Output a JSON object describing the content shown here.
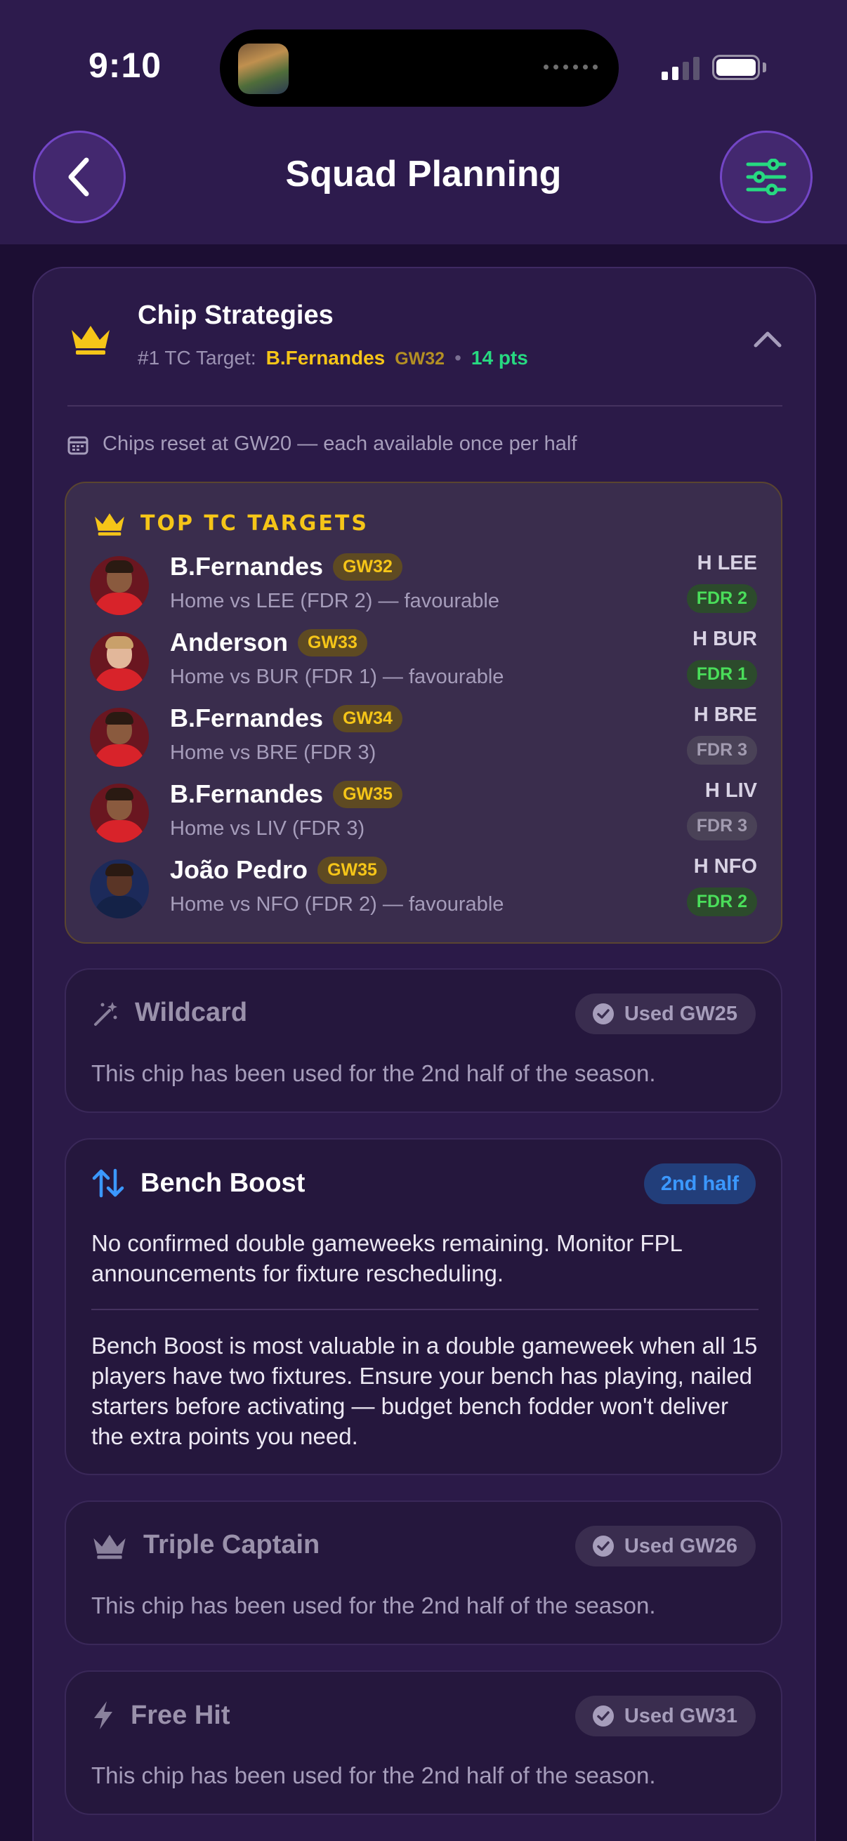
{
  "status_bar": {
    "time": "9:10"
  },
  "header": {
    "title": "Squad Planning",
    "back_icon": "chevron-left-icon",
    "filter_icon": "sliders-icon"
  },
  "chip_strategies": {
    "title": "Chip Strategies",
    "subtitle": {
      "label": "#1 TC Target:",
      "player": "B.Fernandes",
      "gw": "GW32",
      "separator": "•",
      "points": "14 pts"
    },
    "reset_note": "Chips reset at GW20 — each available once per half"
  },
  "tc_targets": {
    "heading": "TOP TC TARGETS",
    "rows": [
      {
        "name": "B.Fernandes",
        "gw": "GW32",
        "desc": "Home vs LEE (FDR 2) — favourable",
        "fixture": "H LEE",
        "fdr": "FDR 2",
        "fdr_level": "good"
      },
      {
        "name": "Anderson",
        "gw": "GW33",
        "desc": "Home vs BUR (FDR 1) — favourable",
        "fixture": "H BUR",
        "fdr": "FDR 1",
        "fdr_level": "good"
      },
      {
        "name": "B.Fernandes",
        "gw": "GW34",
        "desc": "Home vs BRE (FDR 3)",
        "fixture": "H BRE",
        "fdr": "FDR 3",
        "fdr_level": "mid"
      },
      {
        "name": "B.Fernandes",
        "gw": "GW35",
        "desc": "Home vs LIV (FDR 3)",
        "fixture": "H LIV",
        "fdr": "FDR 3",
        "fdr_level": "mid"
      },
      {
        "name": "João Pedro",
        "gw": "GW35",
        "desc": "Home vs NFO (FDR 2) — favourable",
        "fixture": "H NFO",
        "fdr": "FDR 2",
        "fdr_level": "good"
      }
    ]
  },
  "chips": {
    "wildcard": {
      "title": "Wildcard",
      "status": "Used GW25",
      "body": "This chip has been used for the 2nd half of the season."
    },
    "bench_boost": {
      "title": "Bench Boost",
      "badge": "2nd half",
      "note": "No confirmed double gameweeks remaining. Monitor FPL announcements for fixture rescheduling.",
      "tip": "Bench Boost is most valuable in a double gameweek when all 15 players have two fixtures. Ensure your bench has playing, nailed starters before activating — budget bench fodder won't deliver the extra points you need."
    },
    "triple_captain": {
      "title": "Triple Captain",
      "status": "Used GW26",
      "body": "This chip has been used for the 2nd half of the season."
    },
    "free_hit": {
      "title": "Free Hit",
      "status": "Used GW31",
      "body": "This chip has been used for the 2nd half of the season."
    }
  },
  "colors": {
    "gold": "#f5c518",
    "green": "#27d981",
    "blue": "#3b98ff",
    "purple_border": "#7346c6"
  }
}
